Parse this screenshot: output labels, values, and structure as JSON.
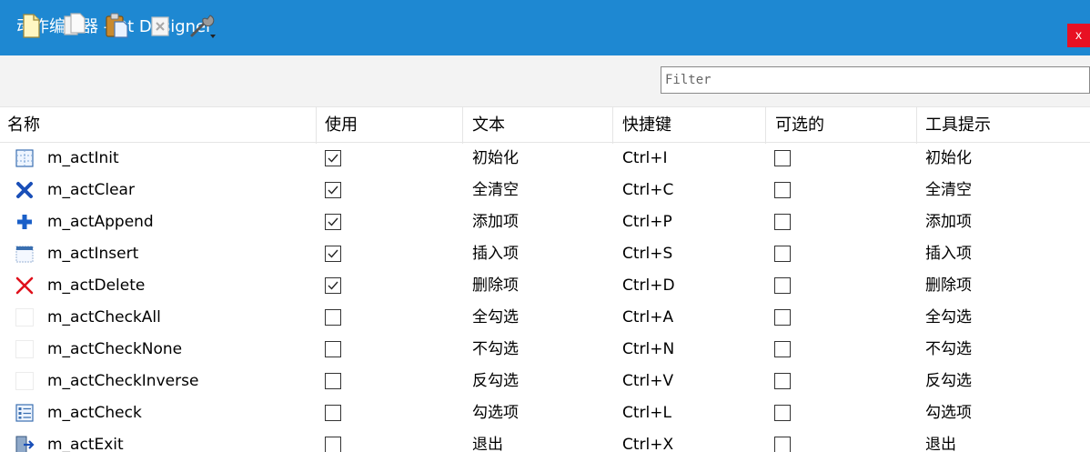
{
  "window": {
    "title": "动作编辑器 - Qt Designer",
    "close_label": "x",
    "title_bar_color": "#1e88d2",
    "close_color": "#e81123"
  },
  "toolbar": {
    "icons": [
      "new-action-icon",
      "copy-icon",
      "paste-icon",
      "delete-icon",
      "configure-icon"
    ],
    "filter_placeholder": "Filter",
    "filter_value": ""
  },
  "table": {
    "headers": [
      "名称",
      "使用",
      "文本",
      "快捷键",
      "可选的",
      "工具提示"
    ],
    "rows": [
      {
        "icon": "grid-icon",
        "name": "m_actInit",
        "used": true,
        "text": "初始化",
        "shortcut": "Ctrl+I",
        "checkable": false,
        "tooltip": "初始化"
      },
      {
        "icon": "clear-x-icon",
        "name": "m_actClear",
        "used": true,
        "text": "全清空",
        "shortcut": "Ctrl+C",
        "checkable": false,
        "tooltip": "全清空"
      },
      {
        "icon": "plus-icon",
        "name": "m_actAppend",
        "used": true,
        "text": "添加项",
        "shortcut": "Ctrl+P",
        "checkable": false,
        "tooltip": "添加项"
      },
      {
        "icon": "insert-row-icon",
        "name": "m_actInsert",
        "used": true,
        "text": "插入项",
        "shortcut": "Ctrl+S",
        "checkable": false,
        "tooltip": "插入项"
      },
      {
        "icon": "delete-x-icon",
        "name": "m_actDelete",
        "used": true,
        "text": "删除项",
        "shortcut": "Ctrl+D",
        "checkable": false,
        "tooltip": "删除项"
      },
      {
        "icon": "",
        "name": "m_actCheckAll",
        "used": false,
        "text": "全勾选",
        "shortcut": "Ctrl+A",
        "checkable": false,
        "tooltip": "全勾选"
      },
      {
        "icon": "",
        "name": "m_actCheckNone",
        "used": false,
        "text": "不勾选",
        "shortcut": "Ctrl+N",
        "checkable": false,
        "tooltip": "不勾选"
      },
      {
        "icon": "",
        "name": "m_actCheckInverse",
        "used": false,
        "text": "反勾选",
        "shortcut": "Ctrl+V",
        "checkable": false,
        "tooltip": "反勾选"
      },
      {
        "icon": "list-icon",
        "name": "m_actCheck",
        "used": false,
        "text": "勾选项",
        "shortcut": "Ctrl+L",
        "checkable": false,
        "tooltip": "勾选项"
      },
      {
        "icon": "exit-icon",
        "name": "m_actExit",
        "used": false,
        "text": "退出",
        "shortcut": "Ctrl+X",
        "checkable": false,
        "tooltip": "退出"
      }
    ]
  }
}
